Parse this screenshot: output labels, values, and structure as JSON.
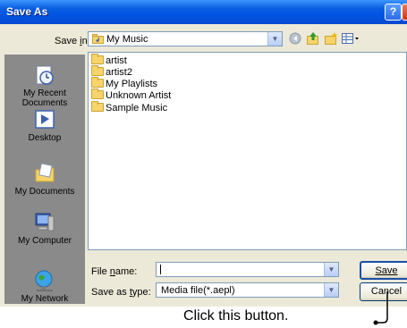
{
  "window": {
    "title": "Save As",
    "help_glyph": "?",
    "close_glyph": "x"
  },
  "toolbar": {
    "save_in_label": "Save in:",
    "save_in_value": "My Music",
    "icons": [
      "back-icon",
      "up-folder-icon",
      "new-folder-icon",
      "views-menu-icon"
    ]
  },
  "places": [
    {
      "label": "My Recent\nDocuments",
      "icon": "recent-documents-icon"
    },
    {
      "label": "Desktop",
      "icon": "desktop-icon"
    },
    {
      "label": "My Documents",
      "icon": "my-documents-icon"
    },
    {
      "label": "My Computer",
      "icon": "my-computer-icon"
    },
    {
      "label": "My Network",
      "icon": "my-network-icon"
    }
  ],
  "files": [
    "artist",
    "artist2",
    "My Playlists",
    "Unknown Artist",
    "Sample Music"
  ],
  "form": {
    "file_name_label": "File name:",
    "file_name_value": "",
    "save_as_type_label": "Save as type:",
    "save_as_type_value": "Media file(*.aepl)"
  },
  "buttons": {
    "save": "Save",
    "cancel": "Cancel"
  },
  "callout": "Click this button.",
  "colors": {
    "title_bar": "#0054e3",
    "dialog_bg": "#ece9d8",
    "places_bg": "#8a8a8a",
    "close_button": "#c83a14"
  }
}
